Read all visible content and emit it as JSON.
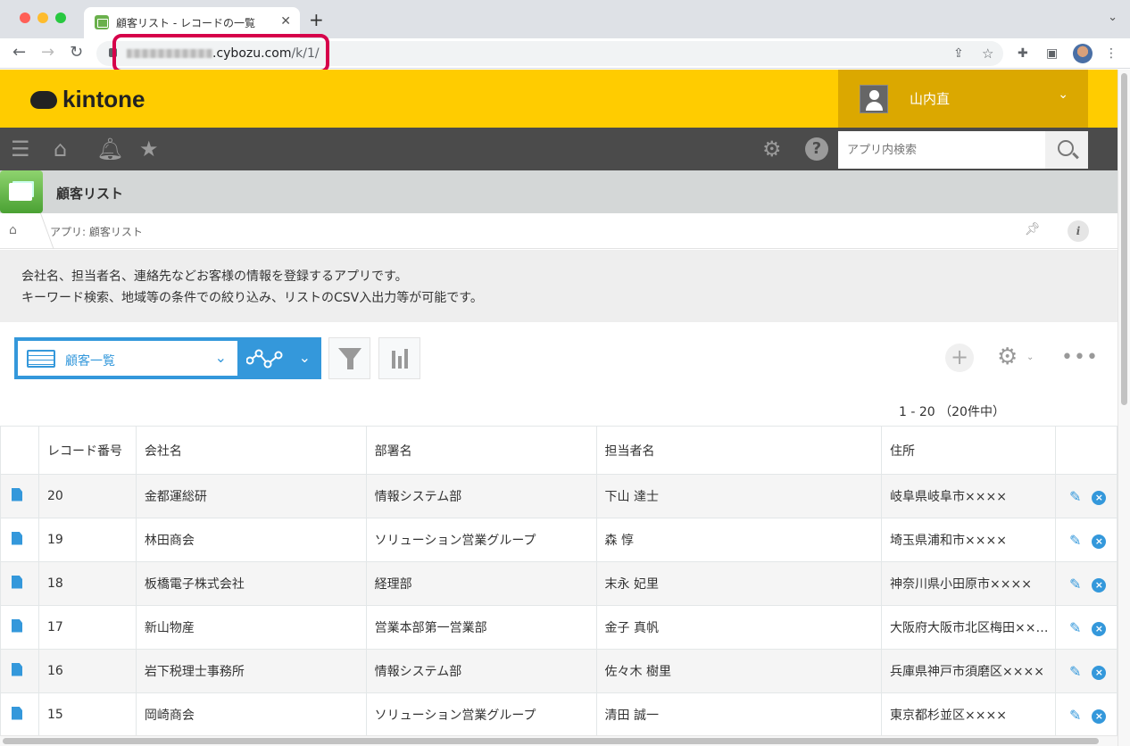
{
  "browser": {
    "tab_title": "顧客リスト - レコードの一覧",
    "url_domain": ".cybozu.com",
    "url_path": "/k/1/"
  },
  "header": {
    "logo": "kintone",
    "user_name": "山内直"
  },
  "search": {
    "placeholder": "アプリ内検索"
  },
  "app": {
    "title": "顧客リスト"
  },
  "breadcrumb": {
    "text": "アプリ: 顧客リスト"
  },
  "description": {
    "line1": "会社名、担当者名、連絡先などお客様の情報を登録するアプリです。",
    "line2": "キーワード検索、地域等の条件での絞り込み、リストのCSV入出力等が可能です。"
  },
  "view": {
    "selected": "顧客一覧"
  },
  "pager": {
    "text": "1 - 20 （20件中）"
  },
  "table": {
    "headers": [
      "",
      "レコード番号",
      "会社名",
      "部署名",
      "担当者名",
      "住所",
      ""
    ],
    "rows": [
      {
        "id": "20",
        "company": "金都運総研",
        "dept": "情報システム部",
        "person": "下山 達士",
        "address": "岐阜県岐阜市××××"
      },
      {
        "id": "19",
        "company": "林田商会",
        "dept": "ソリューション営業グループ",
        "person": "森 惇",
        "address": "埼玉県浦和市××××"
      },
      {
        "id": "18",
        "company": "板橋電子株式会社",
        "dept": "経理部",
        "person": "末永 妃里",
        "address": "神奈川県小田原市××××"
      },
      {
        "id": "17",
        "company": "新山物産",
        "dept": "営業本部第一営業部",
        "person": "金子 真帆",
        "address": "大阪府大阪市北区梅田××…"
      },
      {
        "id": "16",
        "company": "岩下税理士事務所",
        "dept": "情報システム部",
        "person": "佐々木 樹里",
        "address": "兵庫県神戸市須磨区××××"
      },
      {
        "id": "15",
        "company": "岡崎商会",
        "dept": "ソリューション営業グループ",
        "person": "清田 誠一",
        "address": "東京都杉並区××××"
      }
    ]
  },
  "colors": {
    "kintone_yellow": "#ffcc00",
    "accent_blue": "#3498db",
    "highlight": "#d6004a"
  }
}
